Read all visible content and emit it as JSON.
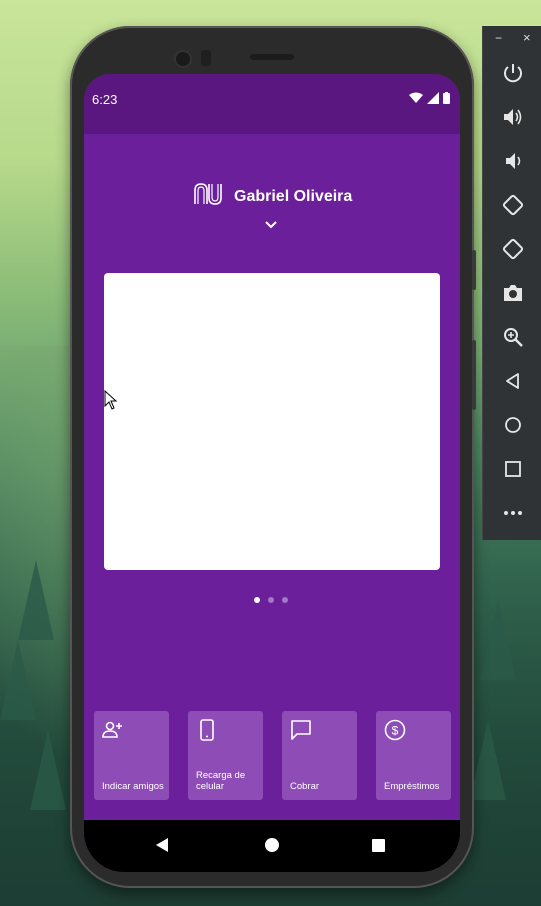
{
  "status_bar": {
    "time": "6:23"
  },
  "app": {
    "user_name": "Gabriel Oliveira",
    "carousel": {
      "page_count": 3,
      "active_index": 0
    },
    "shortcuts": [
      {
        "label": "Indicar amigos",
        "icon": "add-person-icon"
      },
      {
        "label": "Recarga de celular",
        "icon": "phone-icon"
      },
      {
        "label": "Cobrar",
        "icon": "chat-icon"
      },
      {
        "label": "Empréstimos",
        "icon": "dollar-circle-icon"
      }
    ],
    "colors": {
      "primary": "#6c1f9b",
      "status_bar": "#5a1780",
      "shortcut_bg": "#8e4db6"
    }
  },
  "emulator_toolbar": {
    "minimize_label": "−",
    "close_label": "×",
    "buttons": [
      "power-icon",
      "volume-up-icon",
      "volume-down-icon",
      "rotate-left-icon",
      "rotate-right-icon",
      "camera-icon",
      "zoom-icon",
      "back-icon",
      "home-icon",
      "overview-icon",
      "more-icon"
    ]
  }
}
